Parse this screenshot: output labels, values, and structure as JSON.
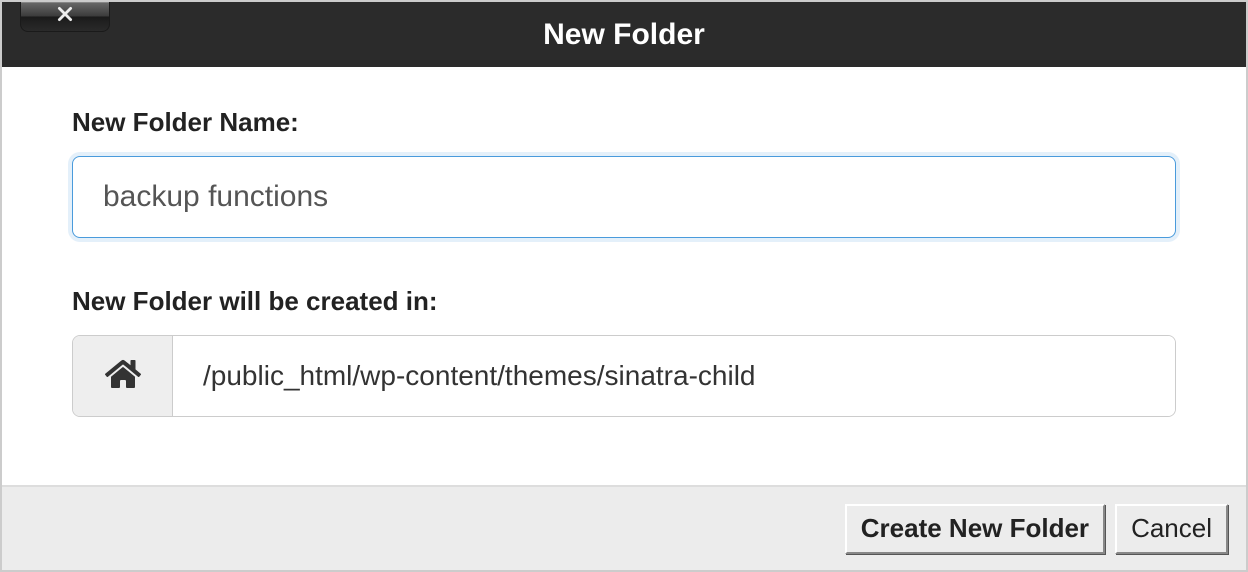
{
  "dialog": {
    "title": "New Folder",
    "name_label": "New Folder Name:",
    "name_value": "backup functions",
    "path_label": "New Folder will be created in:",
    "path_value": "/public_html/wp-content/themes/sinatra-child"
  },
  "footer": {
    "create_label": "Create New Folder",
    "cancel_label": "Cancel"
  }
}
